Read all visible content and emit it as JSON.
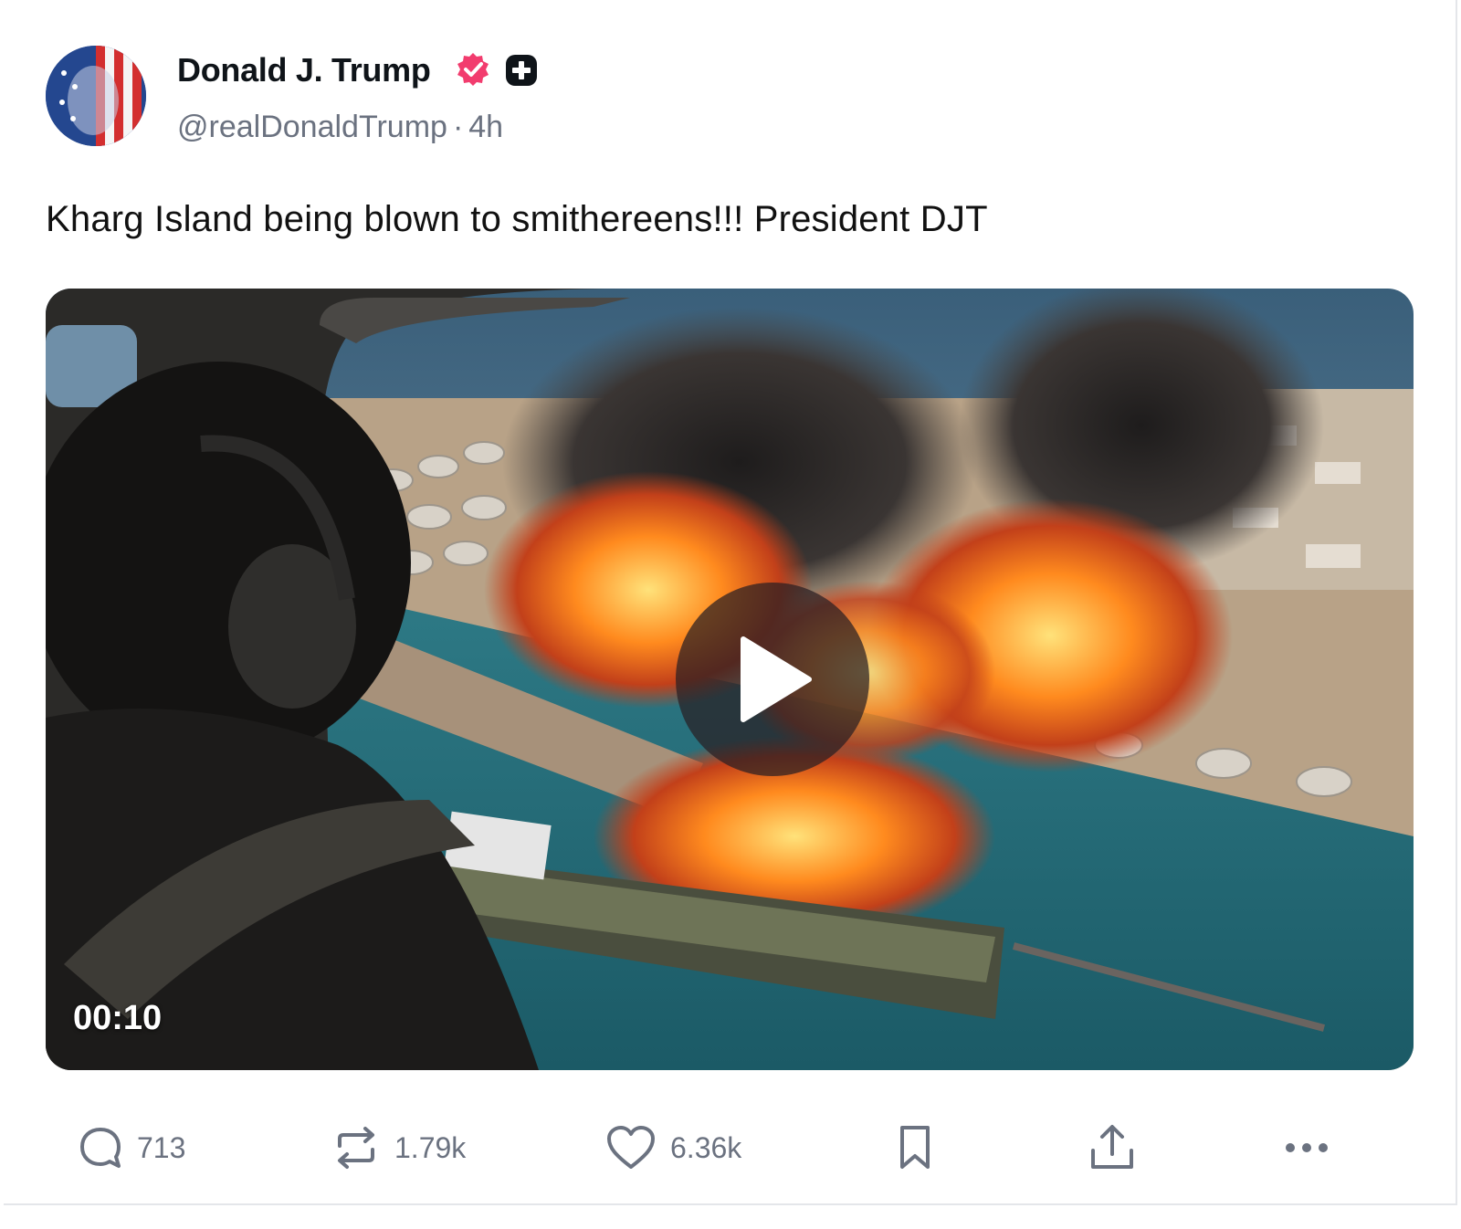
{
  "post": {
    "author_name": "Donald J. Trump",
    "handle": "@realDonaldTrump",
    "separator": "·",
    "time_ago": "4h",
    "text": "Kharg Island being blown to smithereens!!! President DJT",
    "video": {
      "duration": "00:10"
    }
  },
  "actions": {
    "replies": "713",
    "reposts": "1.79k",
    "likes": "6.36k"
  },
  "icons": {
    "verified": "verified-badge-icon",
    "plus": "plus-badge-icon",
    "reply": "comment-icon",
    "repost": "repost-icon",
    "like": "heart-icon",
    "bookmark": "bookmark-icon",
    "share": "share-icon",
    "more": "more-icon",
    "play": "play-icon"
  },
  "colors": {
    "verified": "#f23c6e",
    "text_muted": "#6b7280"
  }
}
